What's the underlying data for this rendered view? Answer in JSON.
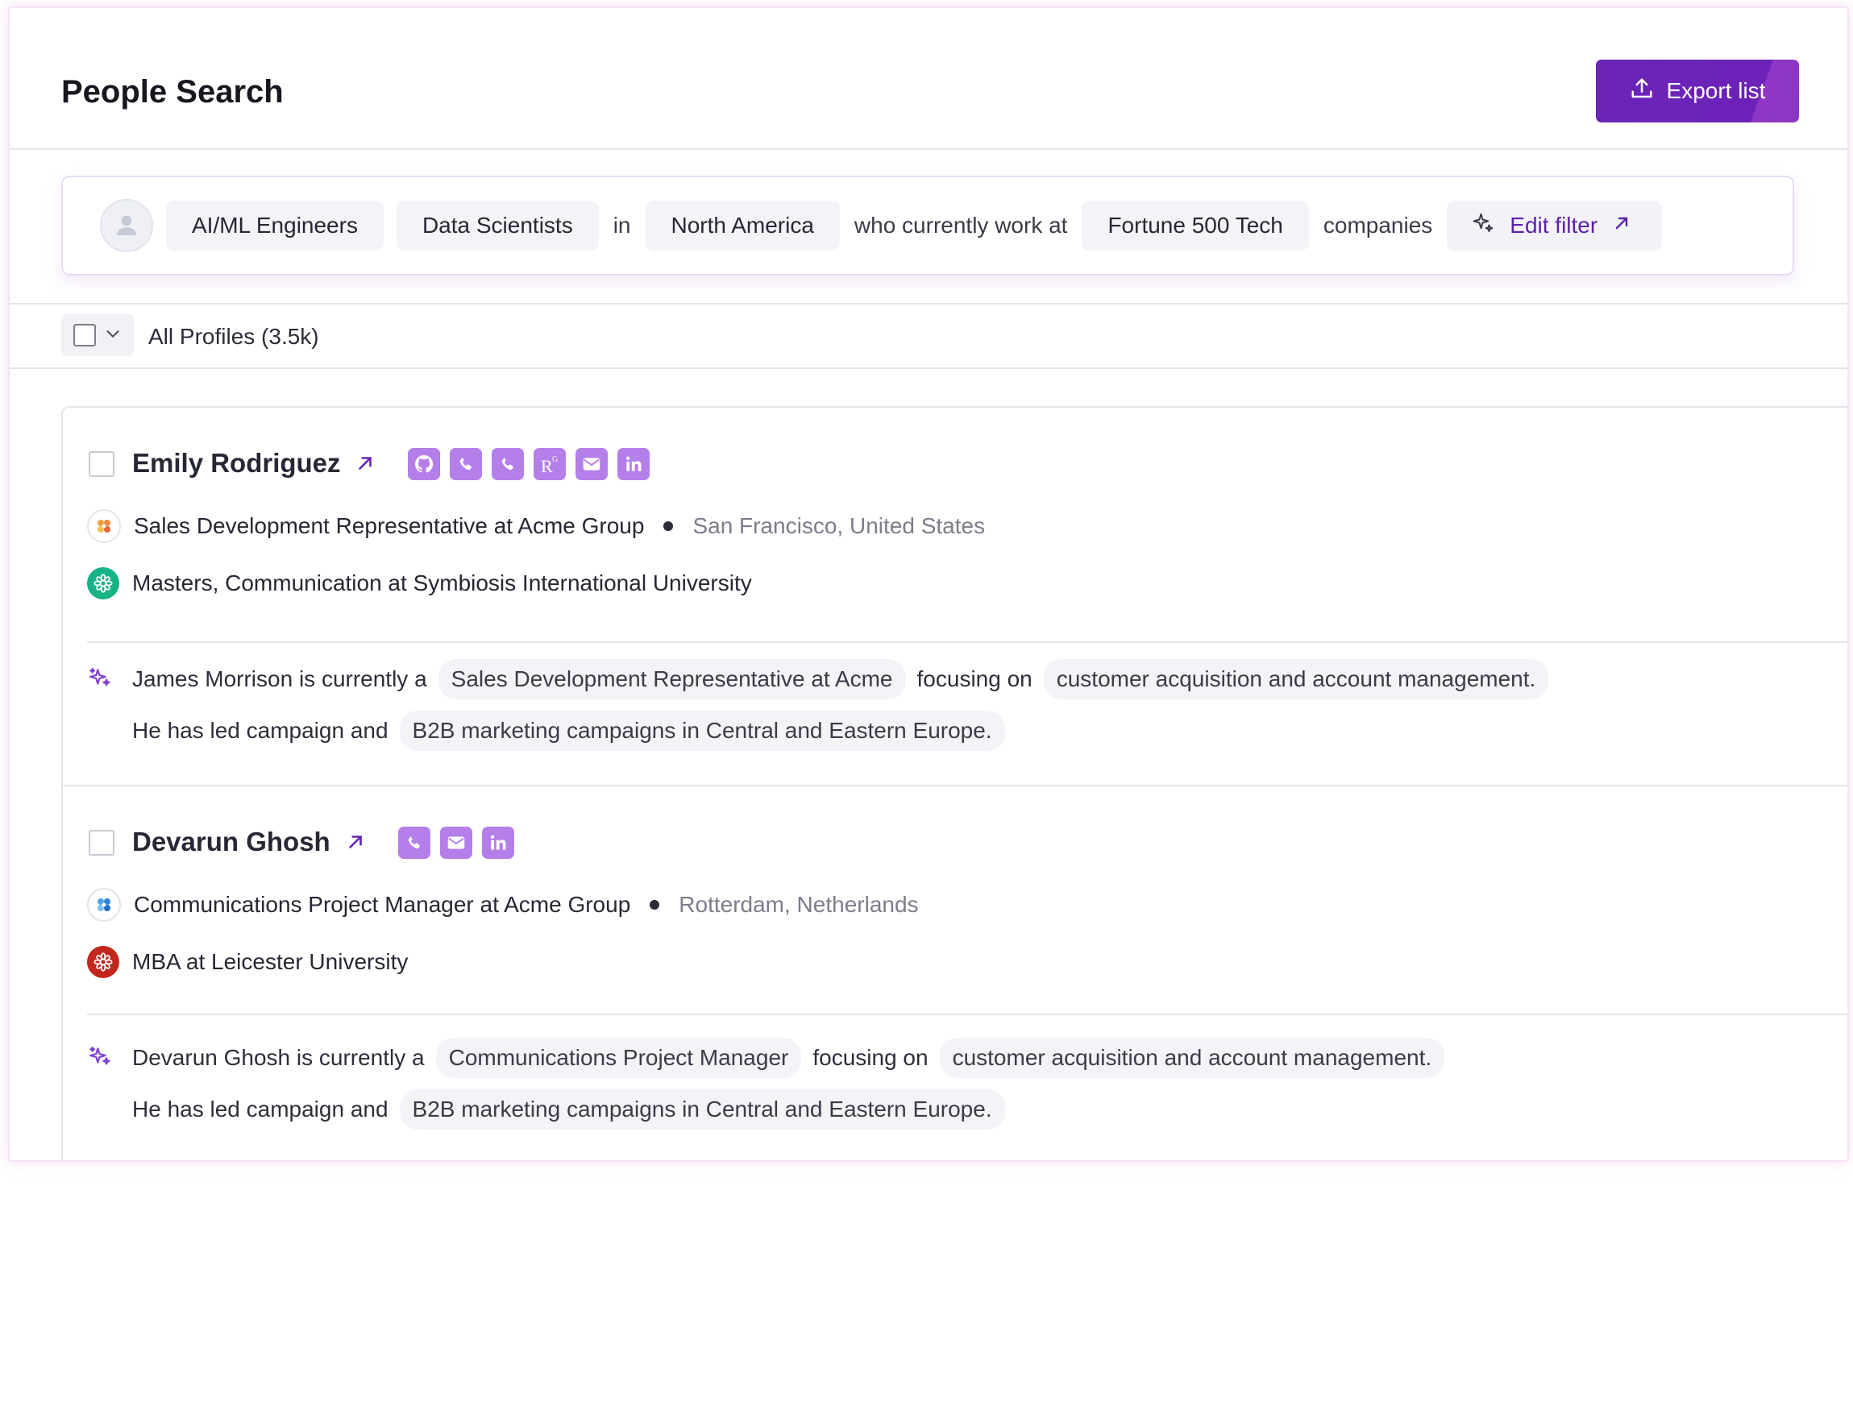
{
  "header": {
    "title": "People Search",
    "export_label": "Export list"
  },
  "filter": {
    "chips": [
      "AI/ML Engineers",
      "Data Scientists",
      "North America",
      "Fortune 500 Tech"
    ],
    "connectors": [
      "in",
      "who currently work at",
      "companies"
    ],
    "edit_label": "Edit filter"
  },
  "toolbar": {
    "profiles_label": "All Profiles (3.5k)"
  },
  "profiles": [
    {
      "name": "Emily Rodriguez",
      "contacts": [
        "github-icon",
        "phone-icon",
        "phone-icon",
        "researchgate-icon",
        "email-icon",
        "linkedin-icon"
      ],
      "role": "Sales Development Representative at Acme Group",
      "location": "San Francisco, United States",
      "education": "Masters, Communication at Symbiosis International University",
      "summary": {
        "intro": "James Morrison is currently a",
        "role_tag": "Sales Development Representative at Acme",
        "focus_word": "focusing on",
        "focus_tag": "customer acquisition and account management.",
        "led": "He has led campaign and",
        "led_tag": "B2B marketing campaigns in Central and Eastern Europe."
      }
    },
    {
      "name": "Devarun Ghosh",
      "contacts": [
        "phone-icon",
        "email-icon",
        "linkedin-icon"
      ],
      "role": "Communications Project Manager at Acme Group",
      "location": "Rotterdam, Netherlands",
      "education": "MBA at Leicester University",
      "summary": {
        "intro": "Devarun Ghosh is currently a",
        "role_tag": "Communications Project Manager",
        "focus_word": "focusing on",
        "focus_tag": "customer acquisition and account management.",
        "led": "He has led campaign and",
        "led_tag": "B2B marketing campaigns in Central and Eastern Europe."
      }
    }
  ],
  "colors": {
    "accent": "#6a24b7",
    "contact_icon_bg": "#b57fea",
    "edu_logo_1": "#17b386",
    "edu_logo_2": "#c2261c"
  }
}
